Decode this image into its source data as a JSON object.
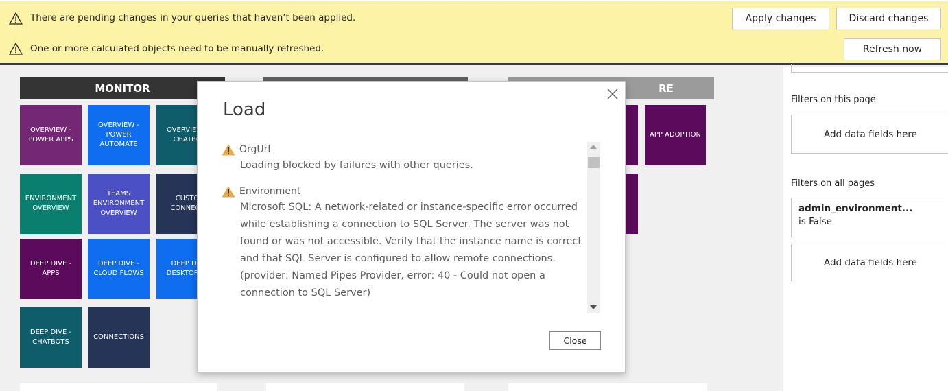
{
  "notifications": {
    "pending": {
      "text": "There are pending changes in your queries that haven’t been applied.",
      "apply_label": "Apply changes",
      "discard_label": "Discard changes",
      "icon": "warning-icon"
    },
    "refresh": {
      "text": "One or more calculated objects need to be manually refreshed.",
      "refresh_label": "Refresh now",
      "icon": "warning-icon"
    }
  },
  "report": {
    "monitor_header": "MONITOR",
    "third_header_fragment": "RE",
    "tiles": {
      "overview_power_apps": "OVERVIEW - POWER APPS",
      "overview_power_automate": "OVERVIEW - POWER AUTOMATE",
      "overview_chatbots": "OVERVIEW - CHATBO",
      "environment_overview": "ENVIRONMENT OVERVIEW",
      "teams_environment_overview": "TEAMS ENVIRONMENT OVERVIEW",
      "custom_connectors": "CUSTO CONNECT",
      "deep_dive_apps": "DEEP DIVE - APPS",
      "deep_dive_cloud_flows": "DEEP DIVE - CLOUD FLOWS",
      "deep_dive_desktop_flows": "DEEP DIV DESKTOP FL",
      "deep_dive_chatbots": "DEEP DIVE - CHATBOTS",
      "connections": "CONNECTIONS",
      "app_adoption": "APP ADOPTION"
    },
    "colors": {
      "purple": "#742774",
      "blue": "#0f6ef0",
      "teal": "#0f5c6b",
      "green": "#0a7f70",
      "indigo": "#4b50c4",
      "navy": "#253457",
      "plum": "#5c0a5c",
      "dark_header": "#343434",
      "mid_header": "#5f5f5f",
      "light_header": "#9b9b9b"
    }
  },
  "filters": {
    "this_page_label": "Filters on this page",
    "add_fields_1": "Add data fields here",
    "all_pages_label": "Filters on all pages",
    "card_title": "admin_environment...",
    "card_value": "is False",
    "add_fields_2": "Add data fields here"
  },
  "dialog": {
    "title": "Load",
    "items": [
      {
        "name": "OrgUrl",
        "message": "Loading blocked by failures with other queries."
      },
      {
        "name": "Environment",
        "message": "Microsoft SQL: A network-related or instance-specific error occurred while establishing a connection to SQL Server. The server was not found or was not accessible. Verify that the instance name is correct and that SQL Server is configured to allow remote connections. (provider: Named Pipes Provider, error: 40 - Could not open a connection to SQL Server)"
      }
    ],
    "close_label": "Close"
  }
}
